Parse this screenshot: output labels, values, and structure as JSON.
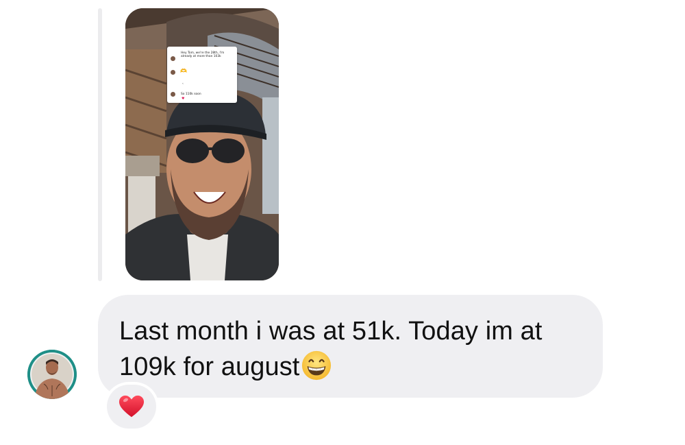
{
  "story_reply": {
    "card_line_1": "Hey Tom, we're the 28th, I'm",
    "card_line_2": "already at more than 103k",
    "card_line_3": "So 110k soon",
    "card_emoji_1": "🫶",
    "card_emoji_2": "👏",
    "card_heart": "♥"
  },
  "message": {
    "text": "Last month i was at 51k. Today im at 109k for august",
    "emoji": "grinning-face-with-smiling-eyes"
  },
  "reaction": {
    "emoji": "red-heart"
  },
  "colors": {
    "bubble_bg": "#efeff2",
    "reply_bar": "#ececee",
    "avatar_ring": "#1f8f87",
    "heart": "#e0245e"
  }
}
